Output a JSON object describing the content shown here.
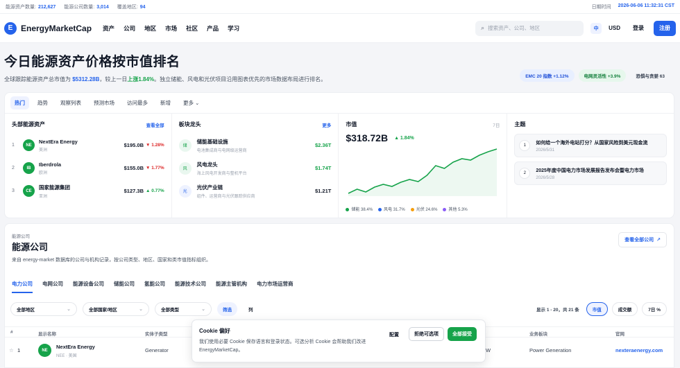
{
  "topstats": {
    "assets_label": "能源资产数量:",
    "assets_value": "212,627",
    "companies_label": "能源公司数量:",
    "companies_value": "3,014",
    "regions_label": "覆盖地区:",
    "regions_value": "94",
    "datetime_label": "日期时间",
    "datetime_value": "2026-06-06 11:32:31 CST"
  },
  "nav": {
    "brand": "EnergyMarketCap",
    "links": [
      "资产",
      "公司",
      "地区",
      "市场",
      "社区",
      "产品",
      "学习"
    ],
    "search_placeholder": "搜索资产、公司、地区",
    "lang": "中",
    "currency": "USD",
    "login": "登录",
    "signup": "注册"
  },
  "hero": {
    "title": "今日能源资产价格按市值排名",
    "desc_pre": "全球跟踪能源资产总市值为 ",
    "desc_total": "$5312.28B",
    "desc_mid": "，较上一日",
    "desc_up": "上涨1.84%",
    "desc_post": "。独立储能、风电和光伏项目沿用图表优先的市场数据布局进行排名。",
    "pills": [
      {
        "label": "EMC 20 指数 +1.12%",
        "style": "blue"
      },
      {
        "label": "电网灵活性 +3.9%",
        "style": "green"
      },
      {
        "label": "恐惧与贪婪 63",
        "style": "plain"
      }
    ]
  },
  "tabs": [
    "热门",
    "趋势",
    "观察列表",
    "预测市场",
    "访问最多",
    "新增",
    "更多"
  ],
  "top_assets": {
    "title": "头部能源资产",
    "more": "查看全部",
    "items": [
      {
        "rank": "1",
        "badge": "NE",
        "name": "NextEra Energy",
        "sub": "美洲",
        "value": "$195.0B",
        "change": "▼ 1.28%",
        "dir": "down"
      },
      {
        "rank": "2",
        "badge": "IB",
        "name": "Iberdrola",
        "sub": "欧洲",
        "value": "$155.0B",
        "change": "▼ 1.77%",
        "dir": "down"
      },
      {
        "rank": "3",
        "badge": "CE",
        "name": "国家能源集团",
        "sub": "亚洲",
        "value": "$127.3B",
        "change": "▲ 0.77%",
        "dir": "up"
      }
    ]
  },
  "sectors": {
    "title": "板块龙头",
    "more": "更多",
    "items": [
      {
        "icon": "储",
        "name": "储能基础设施",
        "sub": "电池集成商与电网级运营商",
        "value": "$2.36T",
        "tone": "green"
      },
      {
        "icon": "风",
        "name": "风电龙头",
        "sub": "海上风电开发商与整机平台",
        "value": "$1.74T",
        "tone": "green"
      },
      {
        "icon": "光",
        "name": "光伏产业链",
        "sub": "组件、运营商与光伏跟踪供应商",
        "value": "$1.21T",
        "tone": "neutral"
      }
    ]
  },
  "market_cap": {
    "title": "市值",
    "period": "7日",
    "value": "$318.72B",
    "change": "▲ 1.84%",
    "legend": [
      {
        "label": "储能 38.4%",
        "color": "#16a34a"
      },
      {
        "label": "风电 31.7%",
        "color": "#2563eb"
      },
      {
        "label": "光伏 24.6%",
        "color": "#f59e0b"
      },
      {
        "label": "其他 5.3%",
        "color": "#8b5cf6"
      }
    ]
  },
  "chart_data": {
    "type": "line",
    "title": "市值",
    "series": [
      {
        "values": [
          270,
          276,
          272,
          279,
          283,
          280,
          286,
          290,
          287,
          296,
          310,
          306,
          315,
          320,
          318,
          325,
          330,
          334
        ]
      }
    ],
    "color": "#16a34a"
  },
  "topics": {
    "title": "主题",
    "items": [
      {
        "num": "1",
        "title": "如何给一个海外电站打分？从国家风险到美元现金流",
        "date": "2026/5/31"
      },
      {
        "num": "2",
        "title": "2025年度中国电力市场发展报告发布会暨电力市场",
        "date": "2026/5/28"
      }
    ]
  },
  "companies": {
    "eyebrow": "能源公司",
    "title": "能源公司",
    "desc": "来自 energy-market 数据库的公司与机构记录，按公司类型、地区、国家和类市值指标组织。",
    "view_all": "查看全部公司",
    "tabs": [
      "电力公司",
      "电网公司",
      "能源设备公司",
      "储能公司",
      "氢能公司",
      "能源技术公司",
      "能源主管机构",
      "电力市场运营商"
    ],
    "filters": [
      "全部地区",
      "全部国家/地区",
      "全部类型"
    ],
    "filter_btn": "筛选",
    "col_btn": "列",
    "count": "显示 1 - 20，共 21 条",
    "view_btns": [
      "市值",
      "成交额",
      "7日 %"
    ],
    "columns": {
      "num": "#",
      "name": "显示名称",
      "type": "实体子类型",
      "sector": "业务板块",
      "site": "官网"
    },
    "row": {
      "rank": "1",
      "badge": "NE",
      "name": "NextEra Energy",
      "sub": "NEE · 美国",
      "type": "Generator",
      "partial": "W",
      "sector": "Power Generation",
      "site": "nexteraenergy.com"
    }
  },
  "cookie": {
    "title": "Cookie 偏好",
    "desc": "我们使用必要 Cookie 保存语言和登录状态。可选分析 Cookie 会帮助我们改进 EnergyMarketCap。",
    "configure": "配置",
    "reject": "拒绝可选项",
    "accept": "全部接受"
  }
}
